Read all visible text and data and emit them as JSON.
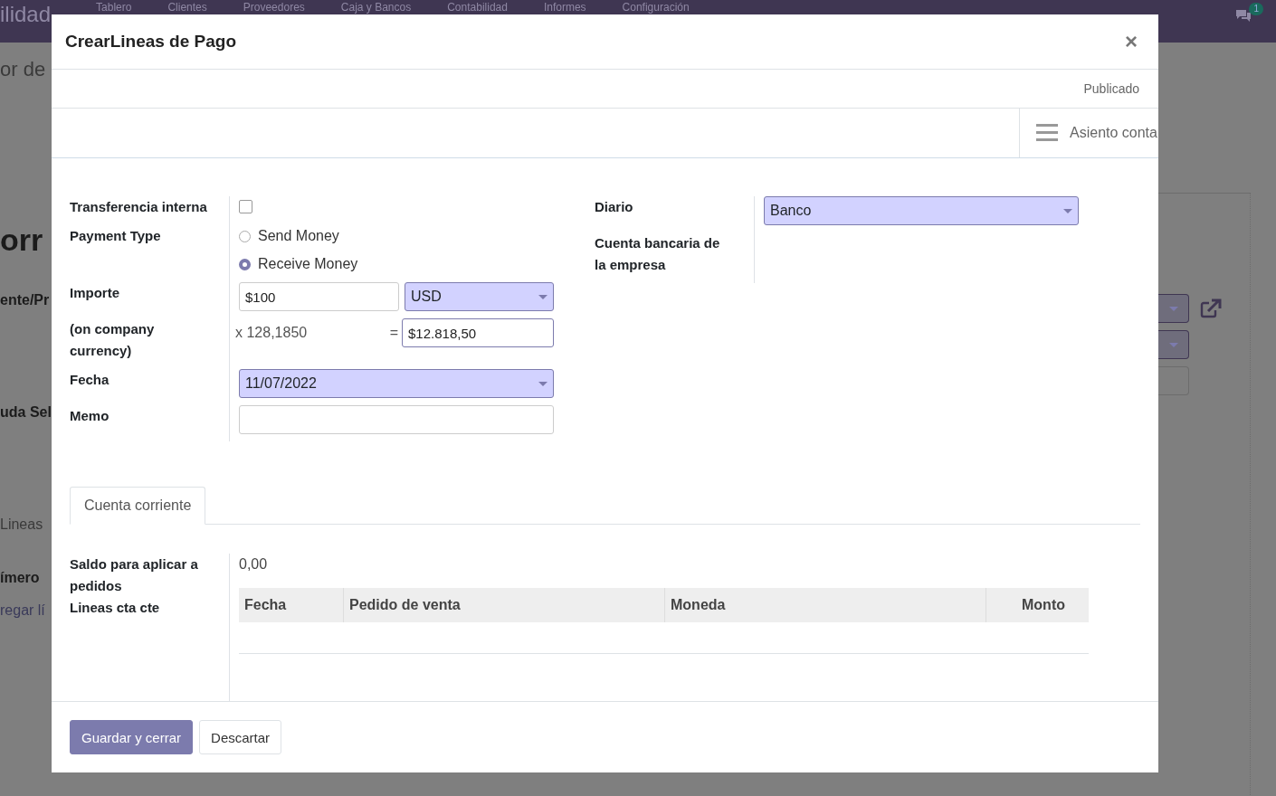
{
  "background": {
    "brand": "ilidad",
    "menu": [
      "Tablero",
      "Clientes",
      "Proveedores",
      "Caja y Bancos",
      "Contabilidad",
      "Informes",
      "Configuración"
    ],
    "messages_badge": "1",
    "page_texts": [
      {
        "kind": "breadcrumb",
        "text": "or de"
      },
      {
        "kind": "title",
        "text": "orr"
      },
      {
        "kind": "label",
        "text": "ente/Pr"
      },
      {
        "kind": "label2",
        "text": "uda Sel"
      },
      {
        "kind": "tab",
        "text": "Lineas"
      },
      {
        "kind": "column",
        "text": "ímero"
      },
      {
        "kind": "link",
        "text": "regar lí"
      }
    ]
  },
  "dialog": {
    "title": "CrearLineas de Pago",
    "close": "×",
    "status": "Publicado",
    "stat_button": "Asiento conta",
    "left": [
      {
        "kind": "checkbox",
        "label": "Transferencia interna",
        "checked": false
      },
      {
        "kind": "radio",
        "label": "Payment Type",
        "options": [
          {
            "label": "Send Money",
            "selected": false
          },
          {
            "label": "Receive Money",
            "selected": true
          }
        ]
      },
      {
        "kind": "amount",
        "label": "Importe",
        "value": "$100",
        "currency": "USD"
      },
      {
        "kind": "conversion",
        "label": "(on company currency)",
        "rate": "x 128,1850",
        "equals": "=",
        "value": "$12.818,50"
      },
      {
        "kind": "select",
        "label": "Fecha",
        "value": "11/07/2022"
      },
      {
        "kind": "input",
        "label": "Memo"
      }
    ],
    "right": [
      {
        "kind": "select",
        "label": "Diario",
        "value": "Banco"
      },
      {
        "kind": "empty",
        "label": "Cuenta bancaria de la empresa"
      }
    ],
    "tabs": [
      {
        "label": "Cuenta corriente",
        "selected": true
      }
    ],
    "tab_content": {
      "balance_label": "Saldo para aplicar a pedidos",
      "balance": "0,00",
      "lines_label": "Lineas cta cte",
      "columns": [
        {
          "label": "Fecha"
        },
        {
          "label": "Pedido de venta"
        },
        {
          "label": "Moneda"
        },
        {
          "label": "Monto"
        }
      ]
    },
    "buttons": [
      {
        "label": "Guardar y cerrar",
        "kind": "primary"
      },
      {
        "label": "Descartar",
        "kind": "secondary"
      }
    ]
  }
}
